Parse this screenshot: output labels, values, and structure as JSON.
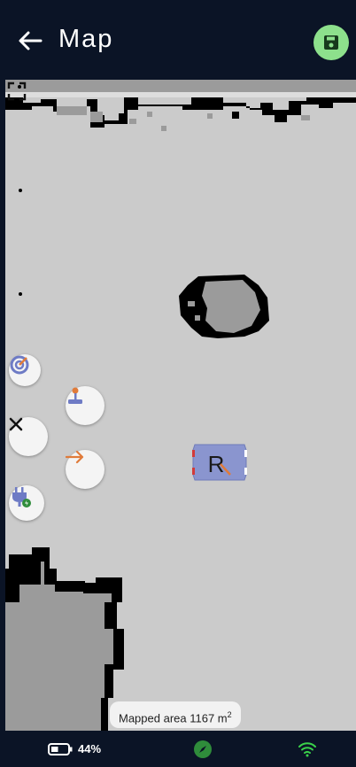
{
  "header": {
    "title": "Map",
    "back_icon": "arrow-left-icon",
    "save_icon": "floppy-disk-icon",
    "save_color": "#8de08c"
  },
  "map": {
    "free_color": "#cbcbcb",
    "wall_color": "#000000",
    "unknown_color": "#9b9b9b",
    "robot": {
      "label": "R",
      "color": "#8a95cf"
    },
    "area_label_prefix": "Mapped area 1167 m",
    "area_label_unit_sup": "2"
  },
  "controls": {
    "target_icon": "target-icon",
    "joystick_icon": "joystick-icon",
    "close_icon": "close-icon",
    "arrow_icon": "arrow-right-icon",
    "dock_icon": "charging-plug-icon",
    "fullscreen_icon": "fullscreen-icon"
  },
  "status": {
    "battery_percent": "44%",
    "battery_level": 0.44,
    "compass_icon": "compass-icon",
    "compass_color": "#2f8c3b",
    "wifi_icon": "wifi-icon",
    "wifi_color": "#3ad24a"
  }
}
